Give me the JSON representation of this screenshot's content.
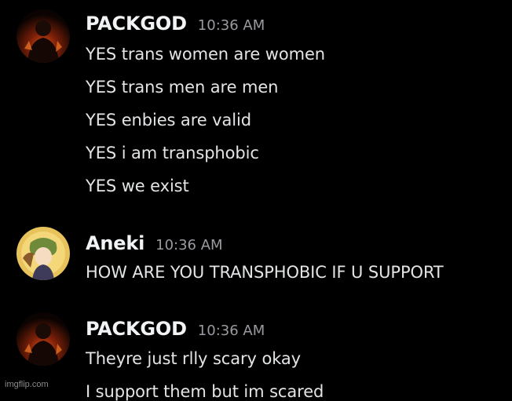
{
  "messages": [
    {
      "username": "PACKGOD",
      "timestamp": "10:36 AM",
      "avatar_icon": "dark-figure-avatar",
      "lines": [
        "YES trans women are women",
        "YES trans men are men",
        "YES enbies are valid",
        "YES i am transphobic",
        "YES we exist"
      ]
    },
    {
      "username": "Aneki",
      "timestamp": "10:36 AM",
      "avatar_icon": "anime-character-avatar",
      "lines": [
        "HOW ARE YOU TRANSPHOBIC IF U SUPPORT"
      ]
    },
    {
      "username": "PACKGOD",
      "timestamp": "10:36 AM",
      "avatar_icon": "dark-figure-avatar",
      "lines": [
        "Theyre just rlly scary okay",
        "I support them but im scared"
      ]
    }
  ],
  "watermark": "imgflip.com",
  "colors": {
    "background": "#000000",
    "username": "#f2f3f5",
    "timestamp": "#9a9ba0",
    "message_text": "#e3e4e6"
  }
}
